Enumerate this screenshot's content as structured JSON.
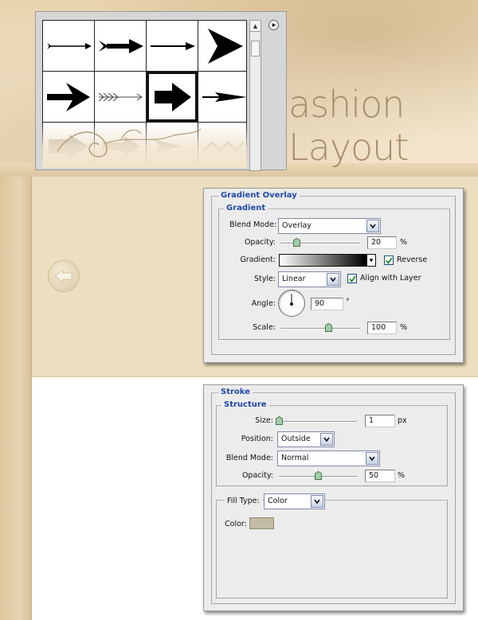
{
  "hero": {
    "title": "ashion Layout"
  },
  "brush_picker": {
    "brushes": [
      "arrow-brush-1",
      "arrow-brush-2",
      "arrow-brush-3",
      "arrow-brush-4",
      "arrow-brush-5",
      "arrow-brush-6",
      "arrow-brush-7",
      "arrow-brush-8",
      "arrow-brush-9",
      "arrow-brush-10",
      "arrow-brush-11",
      "arrow-brush-12"
    ],
    "selected_index": 6
  },
  "gradient_overlay": {
    "title": "Gradient Overlay",
    "section": "Gradient",
    "blend_mode_label": "Blend Mode:",
    "blend_mode": "Overlay",
    "opacity_label": "Opacity:",
    "opacity": "20",
    "opacity_fraction": 0.2,
    "pct": "%",
    "gradient_label": "Gradient:",
    "reverse_label": "Reverse",
    "reverse_checked": true,
    "style_label": "Style:",
    "style": "Linear",
    "align_label": "Align with Layer",
    "align_checked": true,
    "angle_label": "Angle:",
    "angle": "90",
    "degree": "°",
    "scale_label": "Scale:",
    "scale": "100",
    "scale_fraction": 0.6
  },
  "stroke": {
    "title": "Stroke",
    "section": "Structure",
    "size_label": "Size:",
    "size": "1",
    "size_unit": "px",
    "size_fraction": 0.0,
    "position_label": "Position:",
    "position": "Outside",
    "blend_mode_label": "Blend Mode:",
    "blend_mode": "Normal",
    "opacity_label": "Opacity:",
    "opacity": "50",
    "opacity_fraction": 0.5,
    "pct": "%",
    "fill_type_label": "Fill Type:",
    "fill_type": "Color",
    "color_label": "Color:",
    "color": "#c1bba3"
  },
  "colors": {
    "accent": "#2048a8",
    "parchment": "#ebdfbf"
  }
}
